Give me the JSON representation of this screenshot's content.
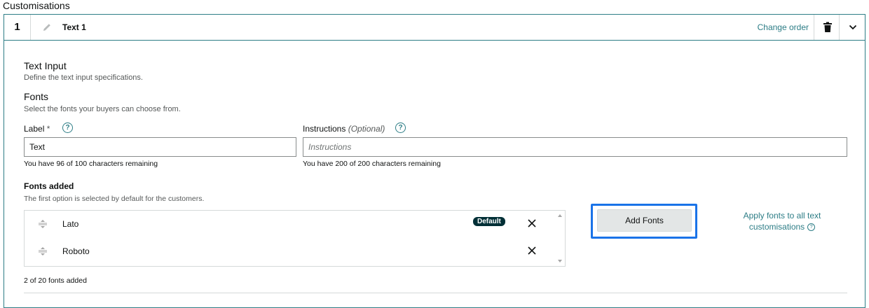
{
  "section_title": "Customisations",
  "header": {
    "step_number": "1",
    "title": "Text 1",
    "change_order": "Change order"
  },
  "text_input": {
    "heading": "Text Input",
    "description": "Define the text input specifications."
  },
  "fonts": {
    "heading": "Fonts",
    "description": "Select the fonts your buyers can choose from."
  },
  "label_field": {
    "label": "Label",
    "required_mark": "*",
    "value": "Text",
    "hint": "You have 96 of 100 characters remaining"
  },
  "instructions_field": {
    "label": "Instructions",
    "optional": "(Optional)",
    "placeholder": "Instructions",
    "hint": "You have 200 of 200 characters remaining"
  },
  "fonts_added": {
    "heading": "Fonts added",
    "description": "The first option is selected by default for the customers.",
    "items": [
      {
        "name": "Lato",
        "badge": "Default"
      },
      {
        "name": "Roboto"
      }
    ],
    "count": "2 of 20 fonts added"
  },
  "add_fonts_label": "Add Fonts",
  "apply_all": {
    "line1": "Apply fonts to all text",
    "line2": "customisations",
    "help_glyph": "?"
  },
  "help_glyph": "?",
  "colors": {
    "accent": "#2d7d86",
    "badge": "#002f36",
    "focus": "#1a73e8"
  }
}
